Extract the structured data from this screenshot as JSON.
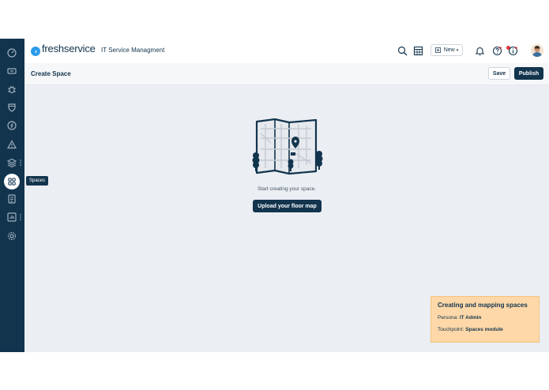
{
  "app": {
    "brand": "freshservice",
    "subtitle": "IT Service Managment"
  },
  "sidebar": {
    "items": [
      {
        "icon": "dashboard-icon"
      },
      {
        "icon": "tickets-icon"
      },
      {
        "icon": "bug-icon"
      },
      {
        "icon": "shield-icon"
      },
      {
        "icon": "changes-icon"
      },
      {
        "icon": "alert-icon"
      },
      {
        "icon": "layers-icon"
      },
      {
        "icon": "spaces-icon",
        "tooltip": "Spaces",
        "active": true
      },
      {
        "icon": "document-icon"
      },
      {
        "icon": "reports-icon"
      },
      {
        "icon": "settings-icon"
      }
    ]
  },
  "topbar": {
    "new_label": "New",
    "icons": [
      "search-icon",
      "calendar-icon",
      "notification-icon",
      "help-icon",
      "info-icon"
    ]
  },
  "subheader": {
    "title": "Create Space",
    "save_label": "Save",
    "publish_label": "Publish"
  },
  "main": {
    "empty_text": "Start creating your space.",
    "upload_label": "Upload your floor map"
  },
  "note": {
    "title": "Creating and mapping spaces",
    "persona_label": "Persona:",
    "persona_value": "IT Admin",
    "touchpoint_label": "Touchpoint:",
    "touchpoint_value": "Spaces module"
  },
  "colors": {
    "sidebar": "#12344d",
    "primary": "#12344d",
    "brand_blue": "#2c9ce8",
    "note_bg": "#fed8a8",
    "canvas": "#ebeef3"
  }
}
